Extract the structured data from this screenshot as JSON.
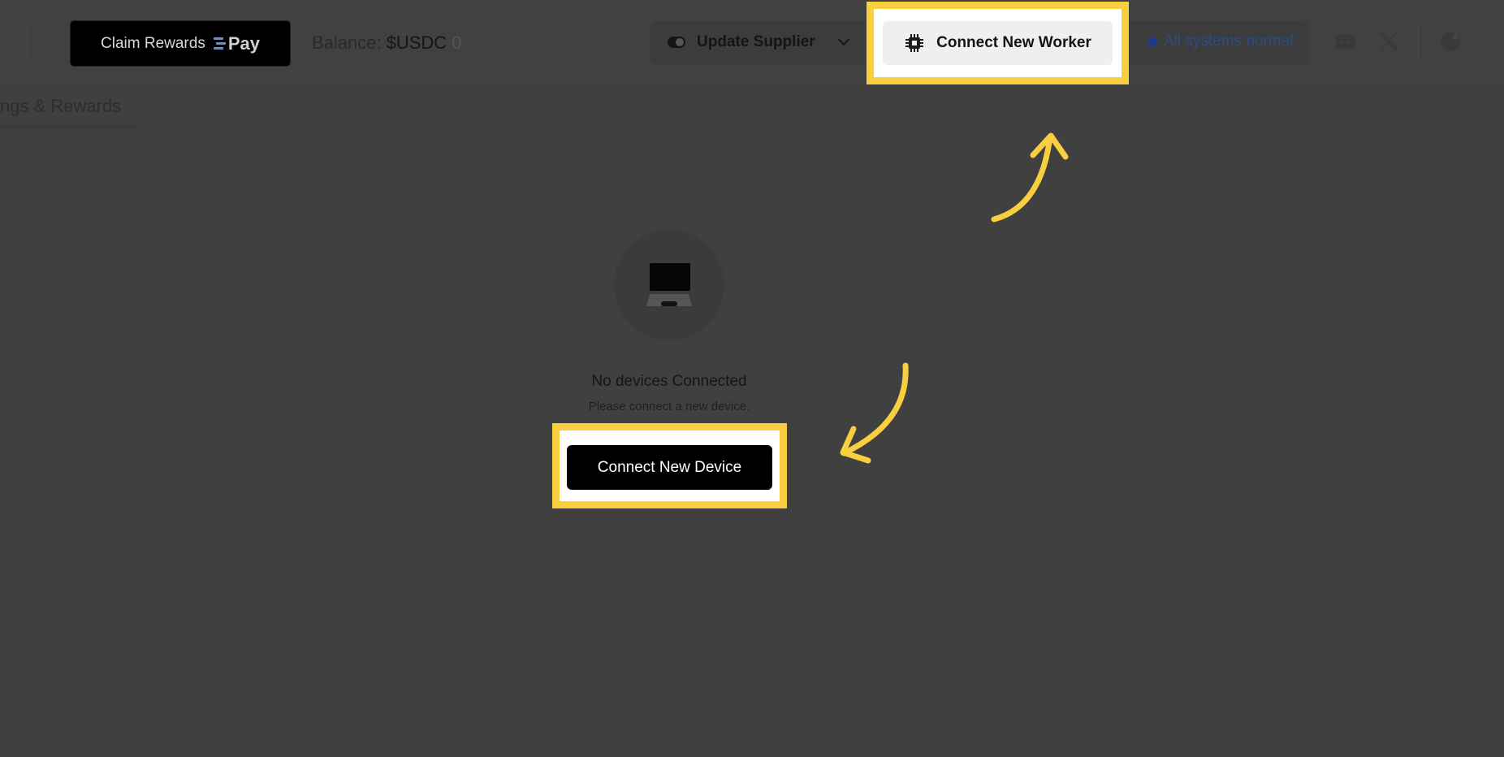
{
  "header": {
    "claim_rewards_label": "Claim Rewards",
    "pay_label": "Pay",
    "balance_label": "Balance:",
    "balance_currency": "$USDC",
    "balance_value": "0",
    "update_supplier_label": "Update Supplier",
    "connect_worker_label": "Connect New Worker",
    "status_text": "All systems normal",
    "icons": [
      "toggle-icon",
      "chevron-down-icon",
      "chip-icon",
      "discord-icon",
      "x-icon",
      "avatar-icon"
    ]
  },
  "tabs": {
    "active_label": "ngs & Rewards"
  },
  "empty_state": {
    "title": "No devices Connected",
    "subtitle": "Please connect a new device.",
    "button_label": "Connect New Device",
    "icon": "computer-icon"
  },
  "colors": {
    "overlay": "#404040",
    "highlight": "#f7cf3f",
    "status_blue": "#1a3c8e",
    "button_black": "#000000"
  }
}
